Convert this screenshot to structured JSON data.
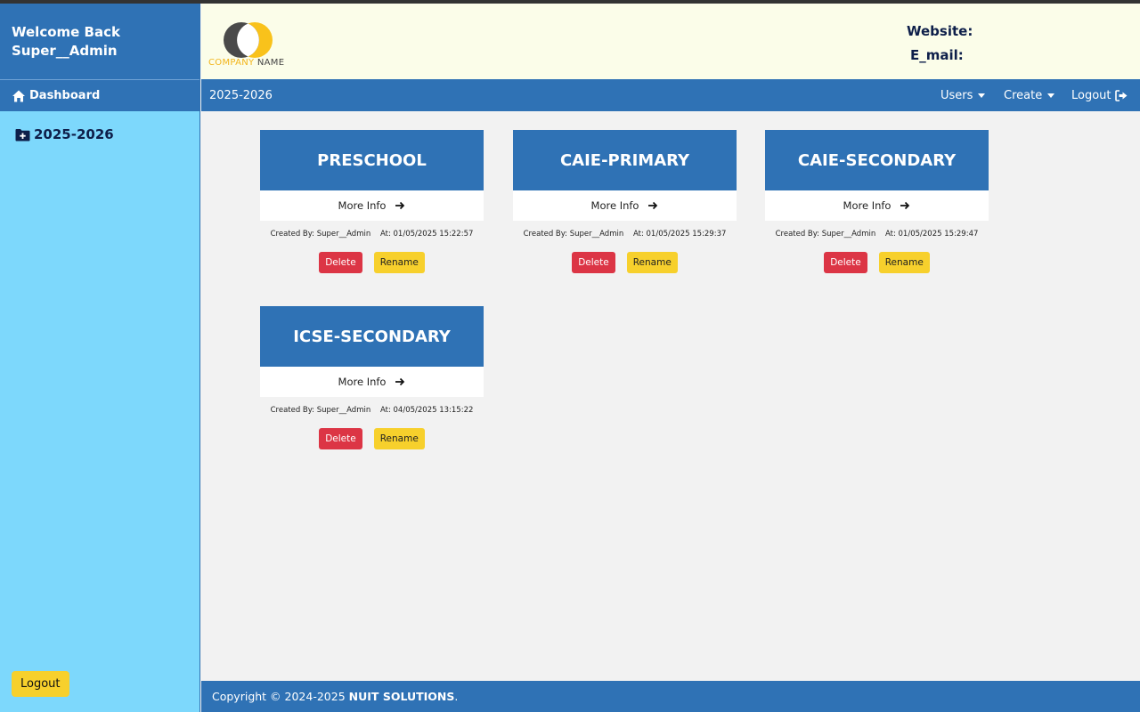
{
  "sidebar": {
    "welcome_line1": "Welcome Back",
    "welcome_line2": "Super__Admin",
    "dashboard_label": "Dashboard",
    "items": [
      {
        "label": "2025-2026"
      }
    ],
    "logout_label": "Logout"
  },
  "header": {
    "logo_company": "COMPANY",
    "logo_name": "NAME",
    "website_label": "Website:",
    "email_label": "E_mail:"
  },
  "navbar": {
    "current_year": "2025-2026",
    "users_label": "Users",
    "create_label": "Create",
    "logout_label": "Logout"
  },
  "cards": [
    {
      "title": "PRESCHOOL",
      "more": "More Info",
      "created_by": "Created By: Super__Admin",
      "created_at": "At: 01/05/2025 15:22:57",
      "delete": "Delete",
      "rename": "Rename"
    },
    {
      "title": "CAIE-PRIMARY",
      "more": "More Info",
      "created_by": "Created By: Super__Admin",
      "created_at": "At: 01/05/2025 15:29:37",
      "delete": "Delete",
      "rename": "Rename"
    },
    {
      "title": "CAIE-SECONDARY",
      "more": "More Info",
      "created_by": "Created By: Super__Admin",
      "created_at": "At: 01/05/2025 15:29:47",
      "delete": "Delete",
      "rename": "Rename"
    },
    {
      "title": "ICSE-SECONDARY",
      "more": "More Info",
      "created_by": "Created By: Super__Admin",
      "created_at": "At: 04/05/2025 13:15:22",
      "delete": "Delete",
      "rename": "Rename"
    }
  ],
  "footer": {
    "copyright": "Copyright © 2024-2025",
    "company": "NUIT SOLUTIONS",
    "suffix": "."
  },
  "colors": {
    "primary": "#2f72b5",
    "sidebar_bg": "#7dd8fc",
    "header_bg": "#fbfde9",
    "danger": "#dc3545",
    "warning": "#f7d02c"
  }
}
